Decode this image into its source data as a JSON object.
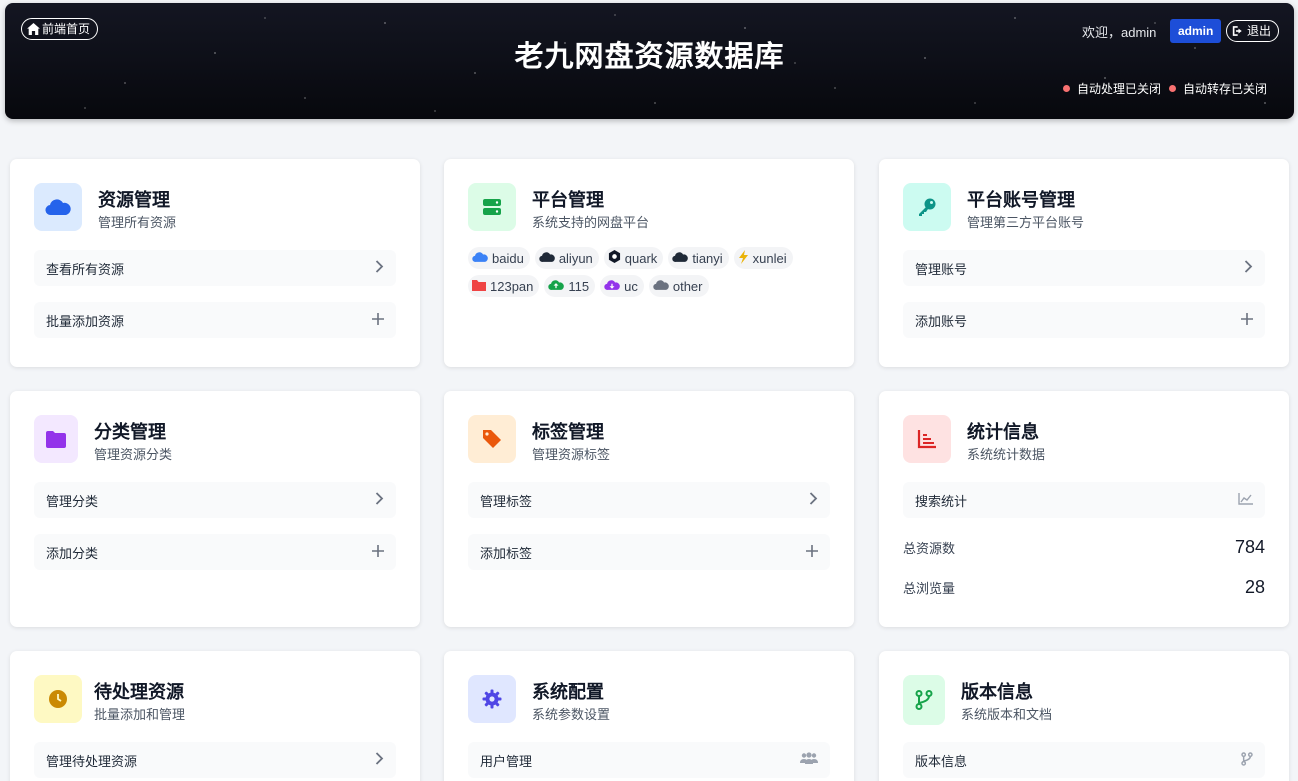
{
  "header": {
    "home_label": "前端首页",
    "title": "老九网盘资源数据库",
    "welcome": "欢迎，admin",
    "admin_badge": "admin",
    "logout_label": "退出",
    "status": [
      "自动处理已关闭",
      "自动转存已关闭"
    ]
  },
  "cards": {
    "resource": {
      "title": "资源管理",
      "subtitle": "管理所有资源",
      "rows": [
        "查看所有资源",
        "批量添加资源"
      ]
    },
    "platform": {
      "title": "平台管理",
      "subtitle": "系统支持的网盘平台",
      "platforms": [
        {
          "name": "baidu",
          "icon": "cloud-icon",
          "color": "#3b82f6"
        },
        {
          "name": "aliyun",
          "icon": "cloud-icon",
          "color": "#1f2937"
        },
        {
          "name": "quark",
          "icon": "quark-icon",
          "color": "#111827"
        },
        {
          "name": "tianyi",
          "icon": "cloud-icon",
          "color": "#1f2937"
        },
        {
          "name": "xunlei",
          "icon": "bolt-icon",
          "color": "#eab308"
        },
        {
          "name": "123pan",
          "icon": "folder-icon",
          "color": "#ef4444"
        },
        {
          "name": "115",
          "icon": "cloud-upload-icon",
          "color": "#16a34a"
        },
        {
          "name": "uc",
          "icon": "cloud-download-icon",
          "color": "#9333ea"
        },
        {
          "name": "other",
          "icon": "cloud-icon",
          "color": "#6b7280"
        }
      ]
    },
    "account": {
      "title": "平台账号管理",
      "subtitle": "管理第三方平台账号",
      "rows": [
        "管理账号",
        "添加账号"
      ]
    },
    "category": {
      "title": "分类管理",
      "subtitle": "管理资源分类",
      "rows": [
        "管理分类",
        "添加分类"
      ]
    },
    "tag": {
      "title": "标签管理",
      "subtitle": "管理资源标签",
      "rows": [
        "管理标签",
        "添加标签"
      ]
    },
    "stats": {
      "title": "统计信息",
      "subtitle": "系统统计数据",
      "row": "搜索统计",
      "total_resources_label": "总资源数",
      "total_resources": "784",
      "total_views_label": "总浏览量",
      "total_views": "28"
    },
    "pending": {
      "title": "待处理资源",
      "subtitle": "批量添加和管理",
      "rows": [
        "管理待处理资源"
      ]
    },
    "config": {
      "title": "系统配置",
      "subtitle": "系统参数设置",
      "rows": [
        "用户管理"
      ]
    },
    "version": {
      "title": "版本信息",
      "subtitle": "系统版本和文档",
      "rows": [
        "版本信息"
      ]
    }
  },
  "colors": {
    "accent": "#1d4ed8",
    "status_dot": "#f87171"
  }
}
